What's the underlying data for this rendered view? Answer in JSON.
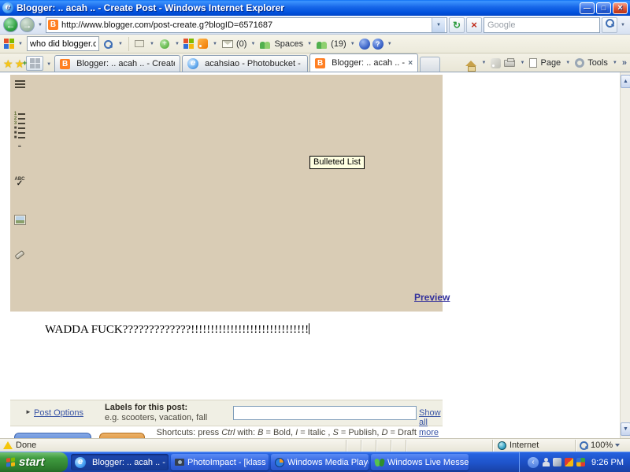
{
  "window": {
    "title": "Blogger: .. acah .. - Create Post - Windows Internet Explorer"
  },
  "glyphs": {
    "back": "←",
    "forward": "→",
    "dropdown": "▼",
    "refresh": "↻",
    "stop": "×",
    "star": "★",
    "overflow": "»",
    "quote": "“",
    "triangle": "►",
    "minimize": "—",
    "maximize": "□",
    "close": "×",
    "tab_close": "×",
    "up": "▲",
    "down": "▼",
    "chevron_left": "‹",
    "ie_e": "e",
    "blogger_b": "B",
    "abc": "ABC",
    "check": "✓",
    "warning": "!"
  },
  "address_bar": {
    "url": "http://www.blogger.com/post-create.g?blogID=6571687",
    "search_placeholder": "Google"
  },
  "live_toolbar": {
    "search_value": "who did blogger.com?",
    "mail_count": "(0)",
    "spaces_label": "Spaces",
    "contacts_count": "(19)"
  },
  "tabs": [
    {
      "label": "Blogger: .. acah .. - Create P..."
    },
    {
      "label": "acahsiao - Photobucket - Vid..."
    },
    {
      "label": "Blogger: .. acah .. - Crea..."
    }
  ],
  "command_bar": {
    "page_label": "Page",
    "tools_label": "Tools"
  },
  "editor": {
    "tooltip": "Bulleted List",
    "preview_label": "Preview",
    "post_text": "WADDA FUCK?????????????!!!!!!!!!!!!!!!!!!!!!!!!!!!!!!"
  },
  "post_options": {
    "link_label": "Post Options",
    "labels_title": "Labels for this post:",
    "labels_hint": "e.g. scooters, vacation, fall",
    "labels_value": "",
    "show_all_label": "Show all"
  },
  "shortcuts": {
    "p1": "Shortcuts: press ",
    "ctrl": "Ctrl",
    "p2": " with: ",
    "b": "B",
    "p3": " = Bold, ",
    "i": "I",
    "p4": " = Italic , ",
    "s": "S",
    "p5": " = Publish, ",
    "d": "D",
    "p6": " = Draft ",
    "more": "more"
  },
  "status_bar": {
    "status": "Done",
    "zone": "Internet",
    "zoom": "100%"
  },
  "taskbar": {
    "start_label": "start",
    "tasks": [
      "Blogger: .. acah .. - ...",
      "PhotoImpact - [klass ...",
      "Windows Media Player",
      "Windows Live Messen..."
    ],
    "clock": "9:26 PM"
  }
}
